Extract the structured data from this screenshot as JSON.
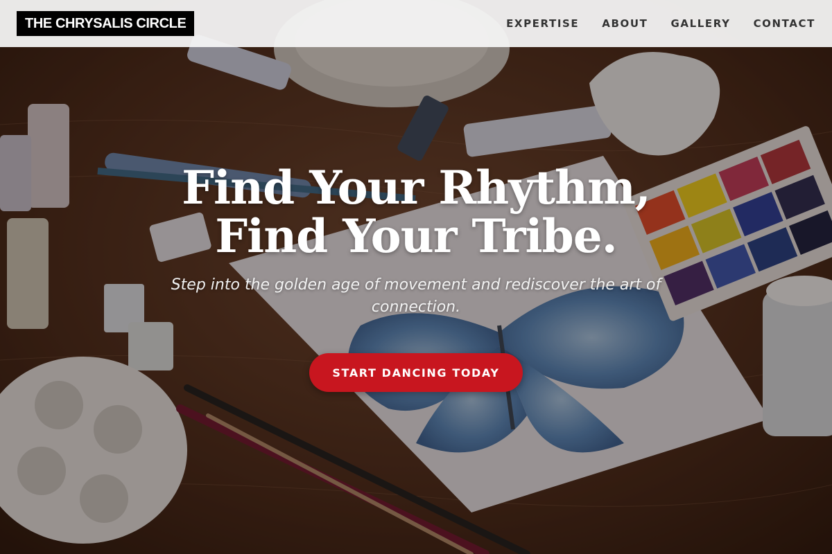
{
  "header": {
    "brand": "THE CHRYSALIS CIRCLE",
    "nav": [
      {
        "label": "EXPERTISE"
      },
      {
        "label": "ABOUT"
      },
      {
        "label": "GALLERY"
      },
      {
        "label": "CONTACT"
      }
    ]
  },
  "hero": {
    "headline_line1": "Find Your Rhythm,",
    "headline_line2": "Find Your Tribe.",
    "subheadline": "Step into the golden age of movement and rediscover the art of connection.",
    "cta_label": "START DANCING TODAY",
    "background_description_icon": "art-supplies-butterfly-painting-photo"
  },
  "colors": {
    "header_bg": "#f5f5f5",
    "brand_bg": "#000000",
    "cta_bg": "#c8161f",
    "text_light": "#ffffff"
  }
}
